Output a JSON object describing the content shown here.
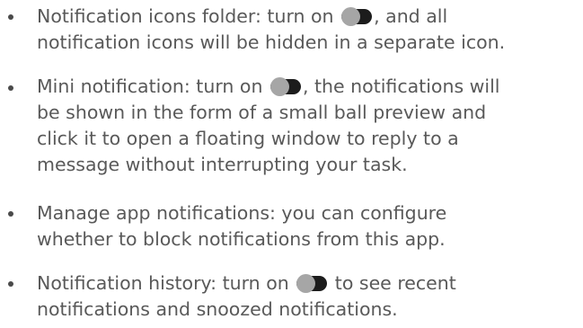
{
  "items": [
    {
      "title": "Notification icons folder",
      "line1_pre": "Notification icons folder: turn on",
      "line1_post": ", and all",
      "line2": "notification icons will be hidden in a separate icon.",
      "toggle_icon": "toggle-switch-icon"
    },
    {
      "title": "Mini notification",
      "line1_pre": "Mini notification: turn on",
      "line1_post": ", the notifications will",
      "line2": "be shown in the form of a small ball preview and",
      "line3": "click it to open a floating window to reply to a",
      "line4": "message  without interrupting your task.",
      "toggle_icon": "toggle-switch-icon"
    },
    {
      "title": "Manage app notifications",
      "line1": "Manage app notifications: you can configure",
      "line2": "whether to block notifications from this app."
    },
    {
      "title": "Notification history",
      "line1_pre": "Notification history: turn on",
      "line1_post": "to see recent",
      "line2": "notifications and snoozed notifications.",
      "toggle_icon": "toggle-switch-icon"
    }
  ],
  "colors": {
    "text": "#595959",
    "bullet": "#4a4a4a",
    "toggle_track": "#1c1c1c",
    "toggle_knob": "#a6a6a6"
  }
}
